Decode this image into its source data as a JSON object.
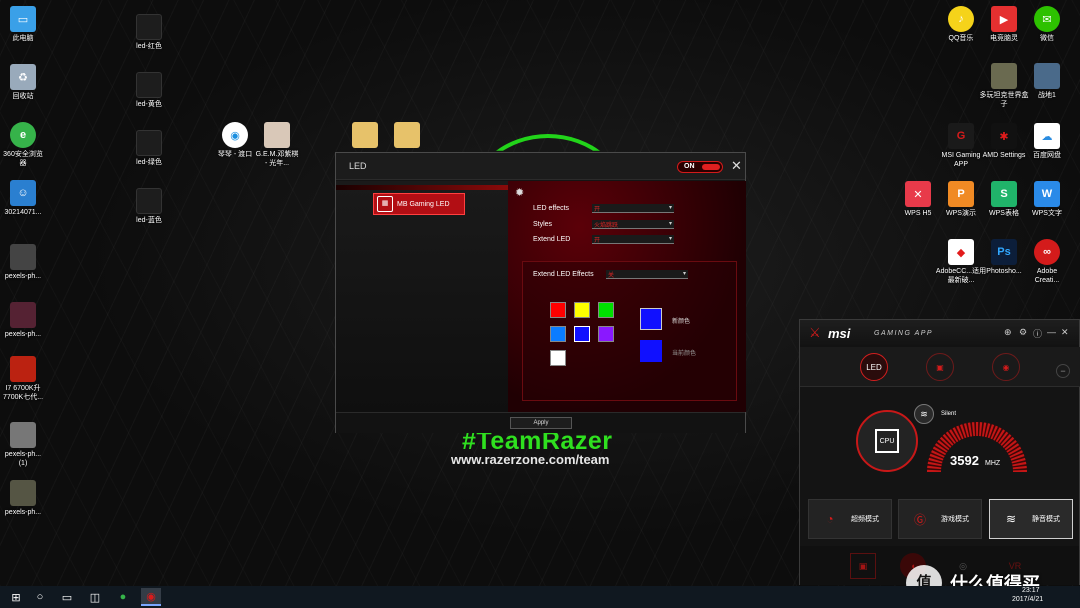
{
  "desktop": {
    "left_icons": [
      {
        "label": "此电脑",
        "icon": "computer-icon"
      },
      {
        "label": "回收站",
        "icon": "recycle-bin-icon"
      },
      {
        "label": "360安全浏览器",
        "icon": "browser-icon"
      },
      {
        "label": "30214071...",
        "icon": "photo-icon"
      },
      {
        "label": "pexels-ph...",
        "icon": "image-file-icon"
      },
      {
        "label": "pexels-ph...",
        "icon": "image-file-icon"
      },
      {
        "label": "I7 6700K升7700K七代...",
        "icon": "image-file-icon"
      },
      {
        "label": "pexels-ph... (1)",
        "icon": "image-file-icon"
      },
      {
        "label": "pexels-ph...",
        "icon": "image-file-icon"
      }
    ],
    "led_icons": [
      {
        "label": "led-红色"
      },
      {
        "label": "led-黄色"
      },
      {
        "label": "led-绿色"
      },
      {
        "label": "led-蓝色"
      }
    ],
    "mid_icons": [
      {
        "label": "琴琴 - 渡口"
      },
      {
        "label": "G.E.M.邓紫棋 - 光年..."
      }
    ],
    "right_icons": [
      {
        "label": "QQ音乐"
      },
      {
        "label": "电竞脑灵"
      },
      {
        "label": "微信"
      },
      {
        "label": "多玩坦克世界盒子"
      },
      {
        "label": "战地1"
      },
      {
        "label": "MSI Gaming APP"
      },
      {
        "label": "AMD Settings"
      },
      {
        "label": "百度网盘"
      },
      {
        "label": "WPS H5"
      },
      {
        "label": "WPS演示"
      },
      {
        "label": "WPS表格"
      },
      {
        "label": "WPS文字"
      },
      {
        "label": "AdobeCC...适用最新破..."
      },
      {
        "label": "Photosho..."
      },
      {
        "label": "Adobe Creati..."
      }
    ],
    "wallpaper": {
      "tag": "#TeamRazer",
      "url": "www.razerzone.com/team"
    }
  },
  "led_window": {
    "title": "LED",
    "switch_label": "ON",
    "close_icon": "close-icon",
    "device_button": "MB Gaming LED",
    "rows": [
      {
        "label": "LED effects",
        "value": "开"
      },
      {
        "label": "Styles",
        "value": "火焰跳跃"
      },
      {
        "label": "Extend LED",
        "value": "开"
      }
    ],
    "extend_effects": {
      "label": "Extend LED Effects",
      "value": "关"
    },
    "new_color_label": "新颜色",
    "current_color_label": "当前颜色",
    "apply_label": "Apply",
    "colors": {
      "swatches": [
        "#ff0000",
        "#ffff00",
        "#00e000",
        "#0a7cff",
        "#1010ff",
        "#8a18ff",
        "#ffffff"
      ],
      "new_color": "#1010ff",
      "current_color": "#1010ff",
      "accent": "#d31a1a"
    }
  },
  "msi_app": {
    "brand": "msi",
    "subtitle": "GAMING APP",
    "tabs": [
      {
        "label": "LED",
        "active": true
      },
      {
        "label": "",
        "icon": "monitor-icon"
      },
      {
        "label": "",
        "icon": "eye-icon"
      }
    ],
    "silent_label": "Silent",
    "cpu_label": "CPU",
    "frequency": "3592",
    "frequency_unit": "MHZ",
    "modes": [
      {
        "label": "超频模式",
        "icon": "oc-gauge-icon",
        "active": false
      },
      {
        "label": "游戏模式",
        "icon": "gaming-g-icon",
        "active": false
      },
      {
        "label": "静音模式",
        "icon": "silent-wave-icon",
        "active": true
      }
    ],
    "bottom_icons": [
      "display-icon",
      "mouse-icon",
      "shield-icon",
      "vr-icon"
    ]
  },
  "watermark": {
    "circle": "值",
    "text": "什么值得买"
  },
  "taskbar": {
    "time": "23:17",
    "date": "2017/4/21"
  }
}
